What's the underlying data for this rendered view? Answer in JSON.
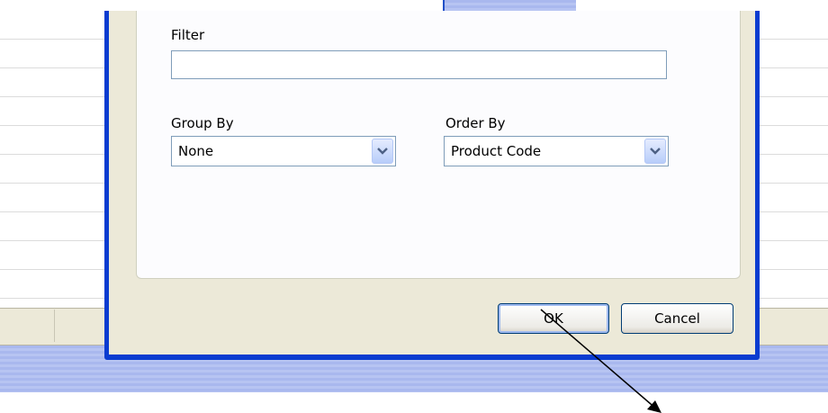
{
  "dialog": {
    "filter": {
      "label": "Filter",
      "value": ""
    },
    "group_by": {
      "label": "Group By",
      "selected": "None"
    },
    "order_by": {
      "label": "Order By",
      "selected": "Product Code"
    },
    "buttons": {
      "ok": "OK",
      "cancel": "Cancel"
    }
  },
  "icons": {
    "dropdown": "chevron-down-icon",
    "pointer": "arrow-annotation"
  },
  "colors": {
    "window_frame": "#0a3cd0",
    "dialog_bg": "#ece9d8",
    "field_border": "#7f9db9"
  }
}
